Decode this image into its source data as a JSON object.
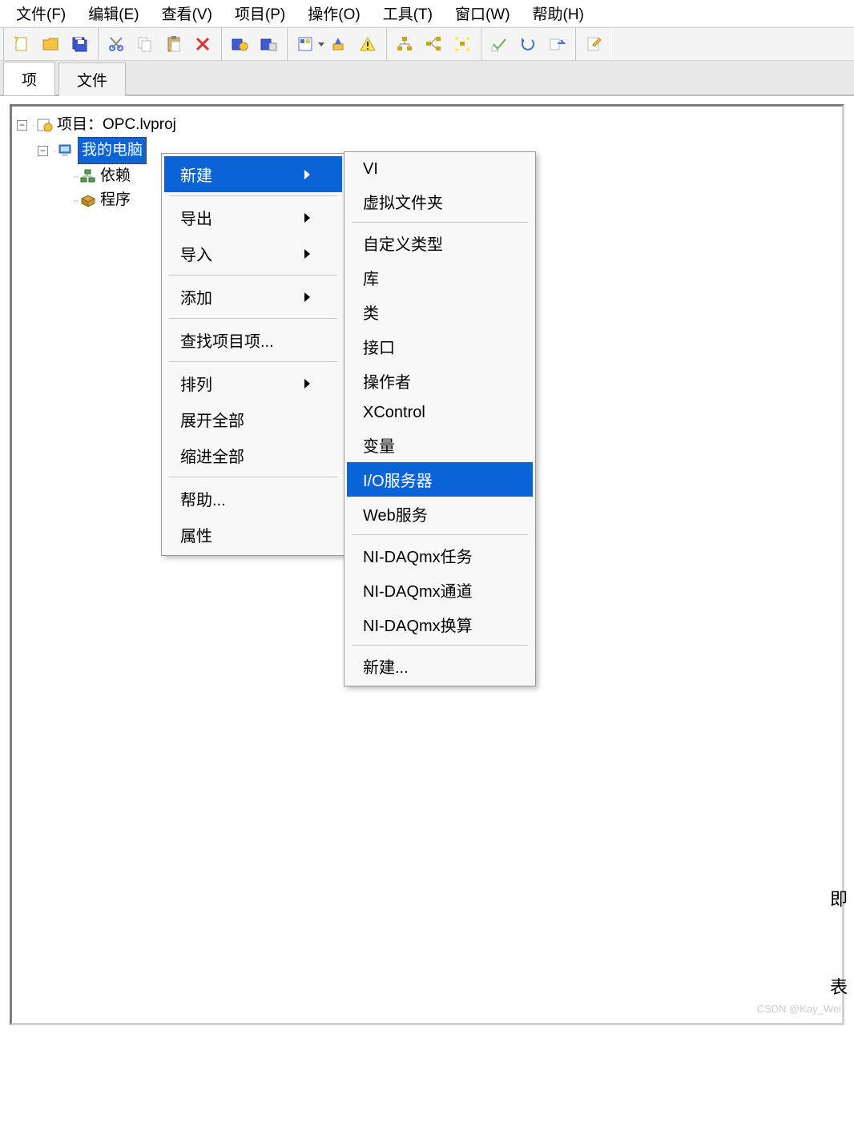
{
  "menubar": [
    "文件(F)",
    "编辑(E)",
    "查看(V)",
    "项目(P)",
    "操作(O)",
    "工具(T)",
    "窗口(W)",
    "帮助(H)"
  ],
  "toolbar_icons": [
    [
      "new-file-icon",
      "open-folder-icon",
      "save-all-icon"
    ],
    [
      "cut-icon",
      "copy-icon",
      "paste-icon",
      "delete-icon"
    ],
    [
      "run-config-icon",
      "distributed-icon"
    ],
    [
      "panel-config-icon",
      "panel-dropdown-icon",
      "highlight-icon",
      "warning-icon"
    ],
    [
      "hierarchy-1-icon",
      "hierarchy-2-icon",
      "hierarchy-3-icon"
    ],
    [
      "accept-icon",
      "undo-icon",
      "redo-icon"
    ],
    [
      "edit-file-icon"
    ]
  ],
  "tabs": {
    "items": [
      "项",
      "文件"
    ],
    "active_index": 0
  },
  "tree": {
    "root_label": "项目：OPC.lvproj",
    "root_icon": "project-icon",
    "computer_label": "我的电脑",
    "computer_icon": "computer-icon",
    "dep_label": "依赖",
    "dep_icon": "dependency-icon",
    "build_label": "程序",
    "build_icon": "build-spec-icon"
  },
  "context_menu": {
    "items": [
      {
        "label": "新建",
        "arrow": true,
        "highlight": true
      },
      {
        "sep": true
      },
      {
        "label": "导出",
        "arrow": true
      },
      {
        "label": "导入",
        "arrow": true
      },
      {
        "sep": true
      },
      {
        "label": "添加",
        "arrow": true
      },
      {
        "sep": true
      },
      {
        "label": "查找项目项..."
      },
      {
        "sep": true
      },
      {
        "label": "排列",
        "arrow": true
      },
      {
        "label": "展开全部"
      },
      {
        "label": "缩进全部"
      },
      {
        "sep": true
      },
      {
        "label": "帮助..."
      },
      {
        "label": "属性"
      }
    ]
  },
  "submenu": {
    "items": [
      {
        "label": "VI"
      },
      {
        "label": "虚拟文件夹"
      },
      {
        "sep": true
      },
      {
        "label": "自定义类型"
      },
      {
        "label": "库"
      },
      {
        "label": "类"
      },
      {
        "label": "接口"
      },
      {
        "label": "操作者"
      },
      {
        "label": "XControl"
      },
      {
        "label": "变量"
      },
      {
        "label": "I/O服务器",
        "highlight": true
      },
      {
        "label": "Web服务"
      },
      {
        "sep": true
      },
      {
        "label": "NI-DAQmx任务"
      },
      {
        "label": "NI-DAQmx通道"
      },
      {
        "label": "NI-DAQmx换算"
      },
      {
        "sep": true
      },
      {
        "label": "新建..."
      }
    ]
  },
  "watermark": "CSDN @Kay_Wei",
  "corner1": "即",
  "corner2": "表"
}
